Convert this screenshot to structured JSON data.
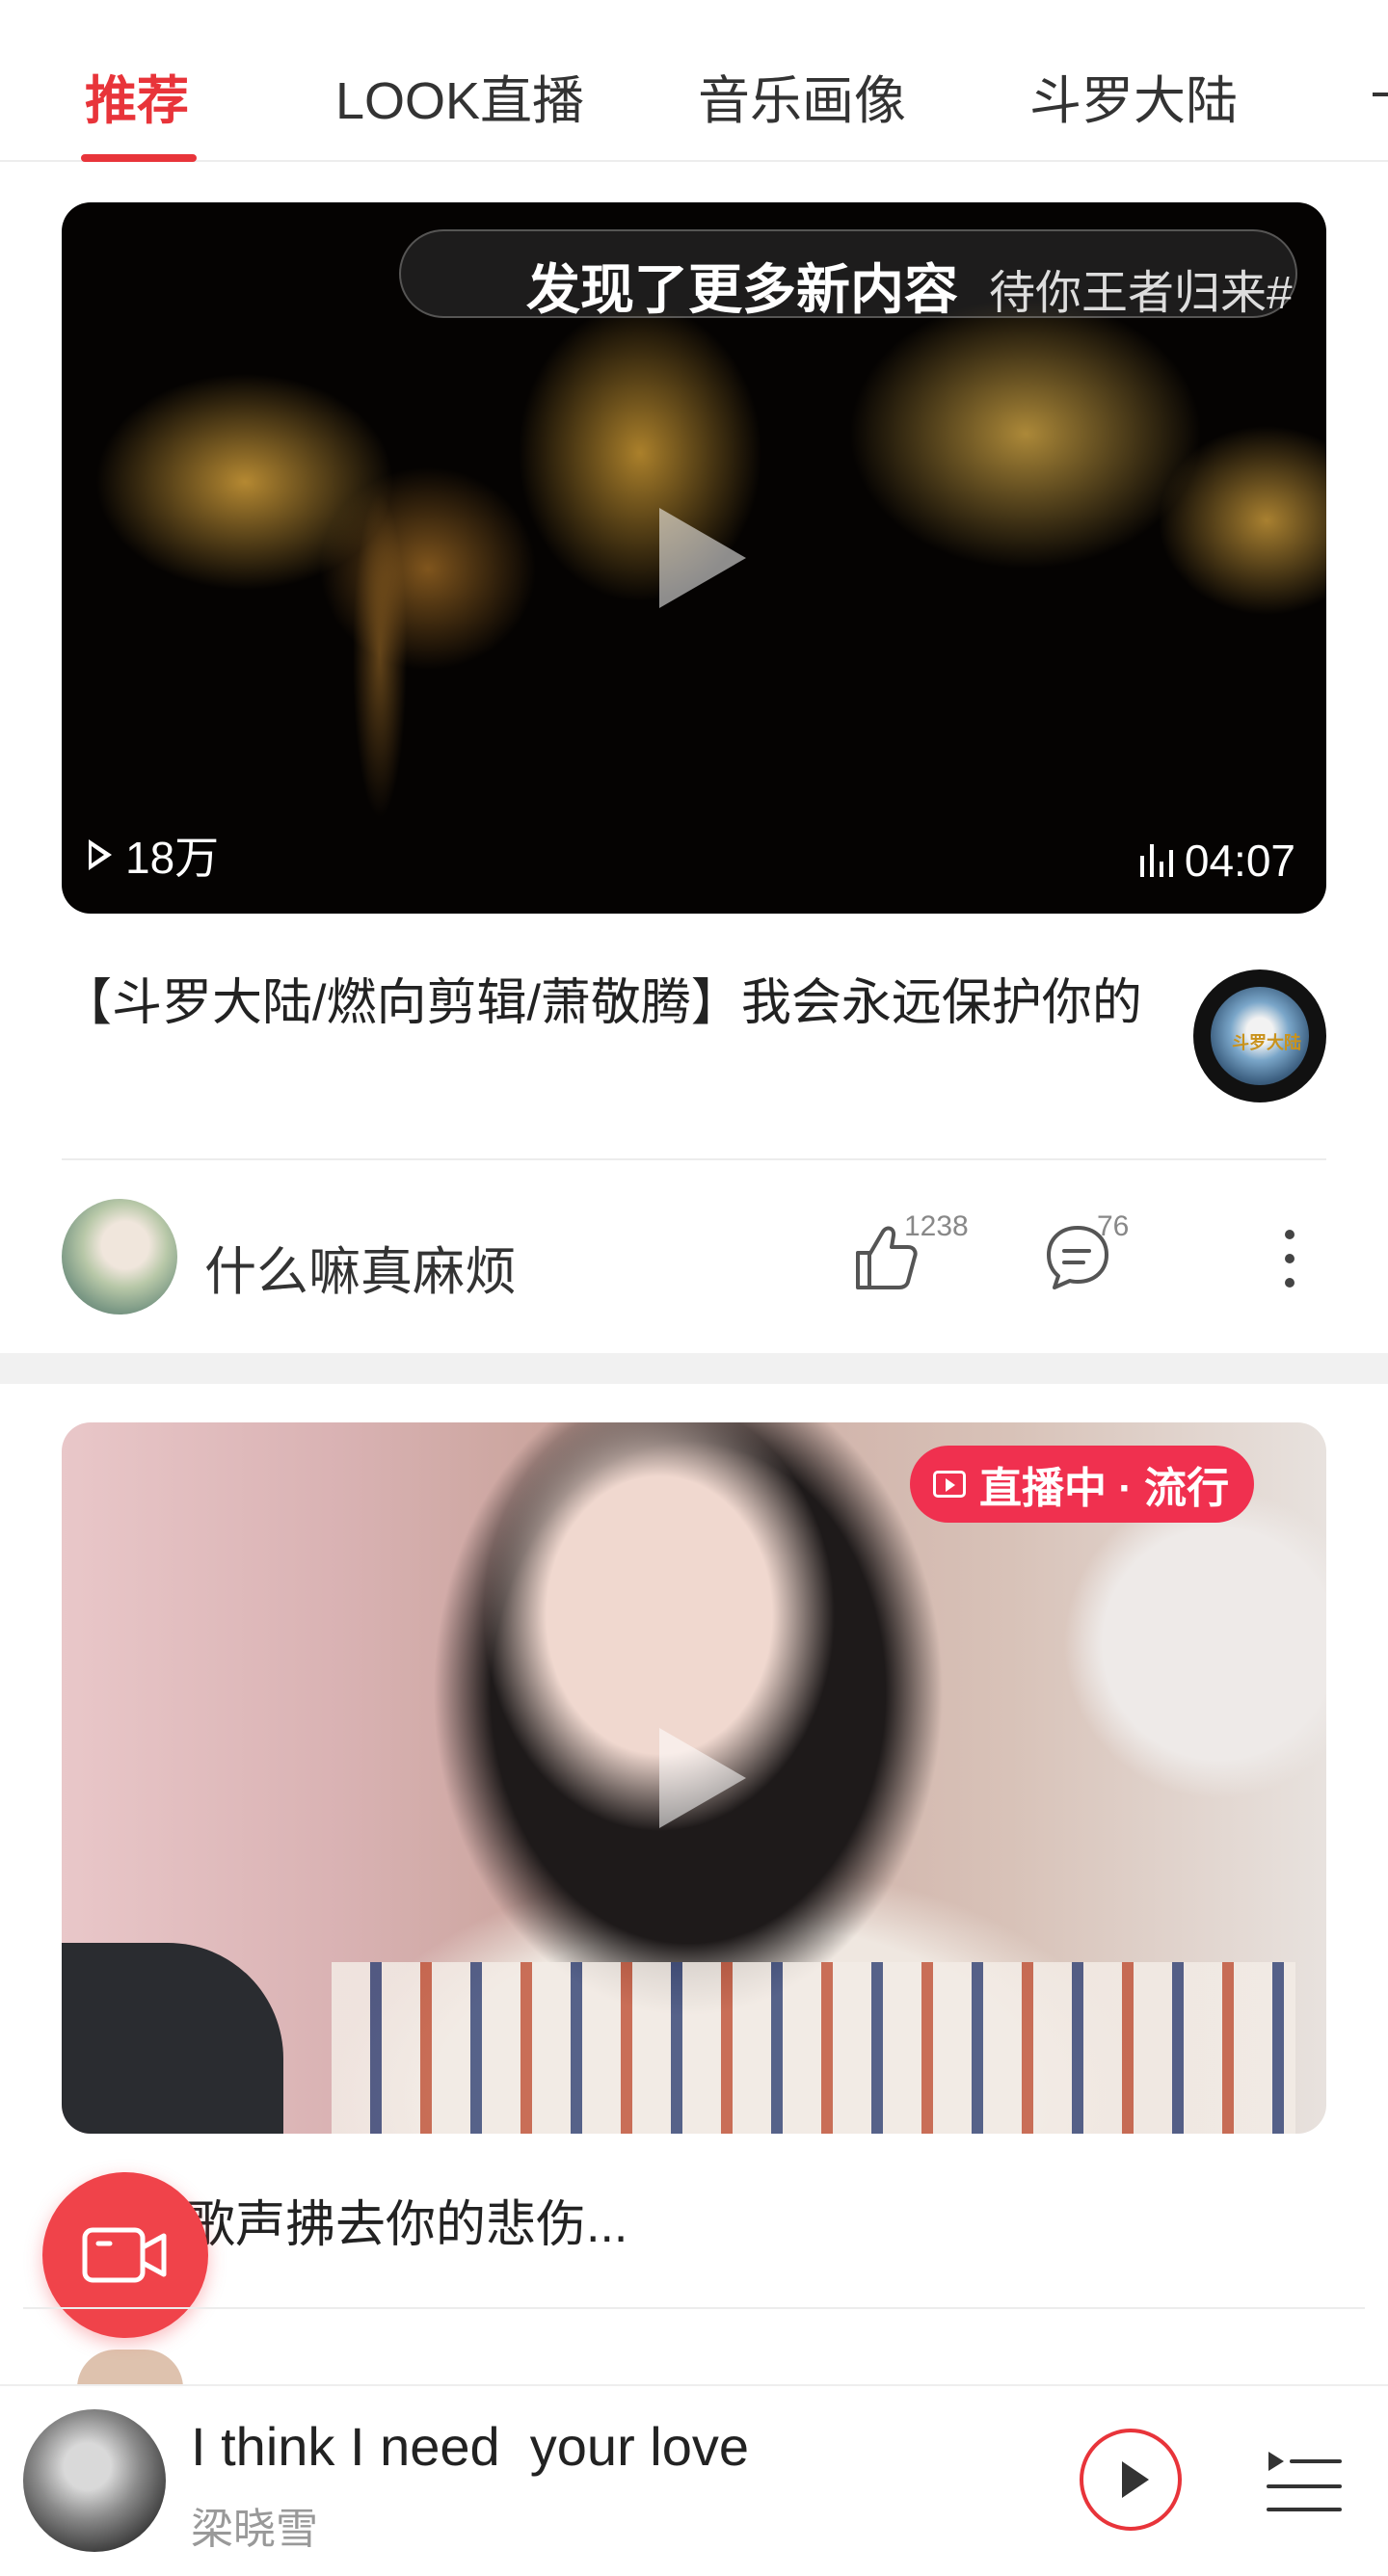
{
  "tabs": [
    {
      "label": "推荐",
      "active": true
    },
    {
      "label": "LOOK直播",
      "active": false
    },
    {
      "label": "音乐画像",
      "active": false
    },
    {
      "label": "斗罗大陆",
      "active": false
    }
  ],
  "feed": {
    "card1": {
      "banner_text": "发现了更多新内容",
      "banner_tag": "待你王者归来#",
      "views": "18万",
      "duration": "04:07",
      "title": "【斗罗大陆/燃向剪辑/萧敬腾】我会永远保护你的",
      "author": "什么嘛真麻烦",
      "likes": "1238",
      "comments": "76",
      "disc_label": "斗罗大陆"
    },
    "card2": {
      "live_label": "直播中 · 流行",
      "title": "歌声拂去你的悲伤..."
    }
  },
  "player": {
    "song_title": "I think I need  your love",
    "artist": "梁晓雪"
  },
  "colors": {
    "accent": "#e8343a",
    "live": "#f0304f",
    "fab": "#f0434a"
  },
  "icons": [
    "play-icon",
    "bars-icon",
    "like-icon",
    "comment-icon",
    "more-icon",
    "live-icon",
    "video-camera-icon",
    "play-circle-icon",
    "playlist-icon"
  ]
}
